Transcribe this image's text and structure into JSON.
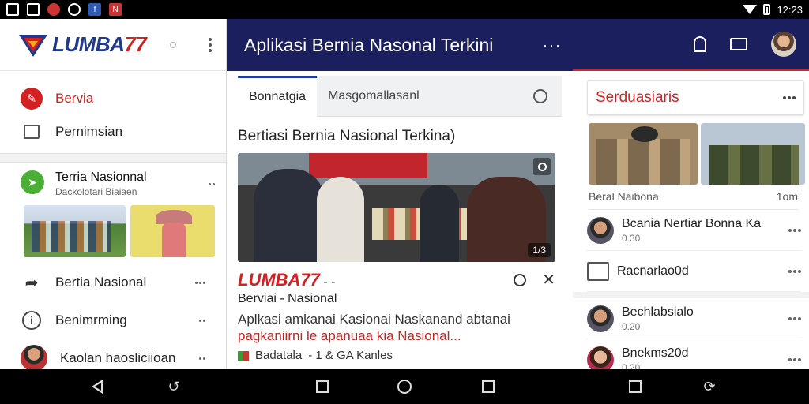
{
  "status": {
    "time": "12:23"
  },
  "drawer": {
    "logo": {
      "text": "LUMBA",
      "num": "77"
    },
    "items_top": [
      {
        "label": "Bervia",
        "icon": "news-icon"
      },
      {
        "label": "Pernimsian",
        "icon": "document-icon"
      }
    ],
    "feature": {
      "title": "Terria Nasionnal",
      "subtitle": "Dackolotari Biaiaen"
    },
    "items": [
      {
        "label": "Bertia Nasional",
        "icon": "share-icon"
      },
      {
        "label": "Benimrming",
        "icon": "info-icon"
      },
      {
        "label": "Kaolan haosliciioan",
        "icon": "avatar"
      }
    ]
  },
  "header": {
    "title": "Aplikasi Bernia Nasonal Terkini",
    "more": "···"
  },
  "tabs": [
    {
      "label": "Bonnatgia"
    },
    {
      "label": "Masgomallasanl"
    }
  ],
  "main": {
    "section_title": "Bertiasi Bernia Nasional Terkina)",
    "hero_count": "1/3",
    "article": {
      "brand": "LUMBA77",
      "brand_tail": " - -",
      "category": "Berviai - Nasional",
      "desc_line1": "Aplkasi amkanai Kasionai Naskanand abtanai",
      "desc_line2_plain": "pagkaniirni le apanuaa ",
      "desc_line2_hl": "kia Nasional...",
      "meta_source": "Badatala",
      "meta_rest": "- 1 & GA Kanles"
    }
  },
  "right": {
    "card_title": "Serduasiaris",
    "sub_left": "Beral Naibona",
    "sub_right": "1om",
    "items": [
      {
        "title": "Bcania Nertiar Bonna Ka",
        "sub": "0.30",
        "kind": "avatar"
      },
      {
        "title": "Racnarlao0d",
        "sub": "",
        "kind": "icon"
      },
      {
        "title": "Bechlabsialo",
        "sub": "0.20",
        "kind": "avatar"
      },
      {
        "title": "Bnekms20d",
        "sub": "0.20",
        "kind": "avatar-f"
      }
    ]
  },
  "colors": {
    "brand_red": "#d32020",
    "header_navy": "#1b1f5e",
    "accent_green": "#4caf35",
    "tab_accent": "#1b3f9a"
  }
}
